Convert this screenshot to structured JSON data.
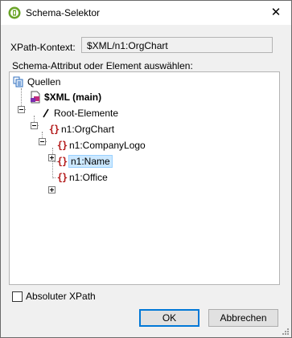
{
  "window": {
    "title": "Schema-Selektor",
    "close_glyph": "✕"
  },
  "xpath": {
    "label": "XPath-Kontext:",
    "value": "$XML/n1:OrgChart"
  },
  "select_label": "Schema-Attribut oder Element auswählen:",
  "tree": {
    "root": "Quellen",
    "source": "$XML (main)",
    "root_elements": "Root-Elemente",
    "orgchart": "n1:OrgChart",
    "children": [
      "n1:CompanyLogo",
      "n1:Name",
      "n1:Office"
    ]
  },
  "checkbox": {
    "label": "Absoluter XPath",
    "checked": false
  },
  "buttons": {
    "ok": "OK",
    "cancel": "Abbrechen"
  },
  "colors": {
    "selection": "#cce8ff",
    "element_icon": "#b31b1b",
    "default_button_border": "#0078d7"
  }
}
